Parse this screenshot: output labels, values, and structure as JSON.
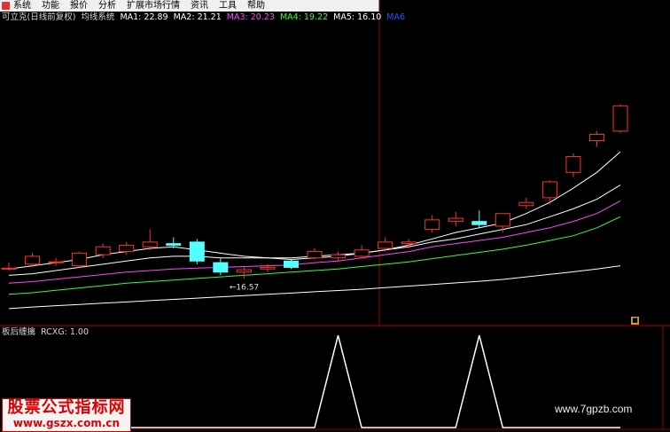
{
  "menu": {
    "items": [
      "系统",
      "功能",
      "报价",
      "分析",
      "扩展市场行情",
      "资讯",
      "工具",
      "帮助"
    ]
  },
  "header": {
    "stock_title": "可立克(日线前复权)",
    "indicator_name": "均线系统",
    "ma": [
      {
        "label": "MA1: 22.89",
        "color": "#ffffff"
      },
      {
        "label": "MA2: 21.21",
        "color": "#ffffff"
      },
      {
        "label": "MA3: 20.23",
        "color": "#ff44ff"
      },
      {
        "label": "MA4: 19.22",
        "color": "#33ff33"
      },
      {
        "label": "MA5: 16.10",
        "color": "#ffffff"
      },
      {
        "label": "MA6",
        "color": "#3050ff"
      }
    ]
  },
  "lower": {
    "title": "板后缠擒",
    "value_label": "RCXG: 1.00"
  },
  "annotation": {
    "low_price": "←16.57"
  },
  "watermarks": {
    "left_cn": "股票公式指标网",
    "left_url": "www.gszx.com.cn",
    "right_url": "www.7gpzb.com"
  },
  "colors": {
    "up": "#ff3030",
    "down": "#54ffff",
    "separator": "#b00000",
    "axis": "#9a0000"
  },
  "chart_data": [
    {
      "type": "candlestick",
      "title": "",
      "candles": [
        {
          "o": 15.9,
          "h": 16.3,
          "l": 15.8,
          "c": 15.95
        },
        {
          "o": 16.2,
          "h": 16.9,
          "l": 16.0,
          "c": 16.7
        },
        {
          "o": 16.3,
          "h": 16.6,
          "l": 16.1,
          "c": 16.35
        },
        {
          "o": 16.1,
          "h": 17.0,
          "l": 16.0,
          "c": 16.9
        },
        {
          "o": 16.8,
          "h": 17.5,
          "l": 16.6,
          "c": 17.3
        },
        {
          "o": 17.0,
          "h": 17.6,
          "l": 16.8,
          "c": 17.4
        },
        {
          "o": 17.3,
          "h": 18.4,
          "l": 17.1,
          "c": 17.6
        },
        {
          "o": 17.5,
          "h": 17.9,
          "l": 17.2,
          "c": 17.4
        },
        {
          "o": 17.6,
          "h": 17.8,
          "l": 16.2,
          "c": 16.4
        },
        {
          "o": 16.3,
          "h": 16.6,
          "l": 15.5,
          "c": 15.7
        },
        {
          "o": 15.7,
          "h": 16.0,
          "l": 15.3,
          "c": 15.85
        },
        {
          "o": 15.9,
          "h": 16.2,
          "l": 15.7,
          "c": 16.0
        },
        {
          "o": 16.4,
          "h": 16.5,
          "l": 15.9,
          "c": 16.0
        },
        {
          "o": 16.6,
          "h": 17.2,
          "l": 16.5,
          "c": 17.0
        },
        {
          "o": 16.6,
          "h": 17.0,
          "l": 16.4,
          "c": 16.8
        },
        {
          "o": 16.7,
          "h": 17.4,
          "l": 16.6,
          "c": 17.1
        },
        {
          "o": 17.2,
          "h": 17.9,
          "l": 17.0,
          "c": 17.6
        },
        {
          "o": 17.5,
          "h": 17.8,
          "l": 17.2,
          "c": 17.6
        },
        {
          "o": 18.4,
          "h": 19.3,
          "l": 18.2,
          "c": 19.0
        },
        {
          "o": 18.9,
          "h": 19.5,
          "l": 18.6,
          "c": 19.1
        },
        {
          "o": 18.9,
          "h": 19.6,
          "l": 18.5,
          "c": 18.7
        },
        {
          "o": 18.6,
          "h": 19.4,
          "l": 18.2,
          "c": 19.4
        },
        {
          "o": 19.9,
          "h": 20.4,
          "l": 19.7,
          "c": 20.1
        },
        {
          "o": 20.4,
          "h": 21.5,
          "l": 20.0,
          "c": 21.4
        },
        {
          "o": 22.0,
          "h": 23.2,
          "l": 21.7,
          "c": 23.0
        },
        {
          "o": 24.0,
          "h": 24.6,
          "l": 23.6,
          "c": 24.4
        },
        {
          "o": 24.6,
          "h": 26.3,
          "l": 24.5,
          "c": 26.2
        }
      ],
      "ma_series": [
        {
          "color": "#ffffff",
          "values": [
            15.9,
            16.1,
            16.3,
            16.5,
            16.8,
            17.0,
            17.2,
            17.3,
            17.1,
            16.9,
            16.7,
            16.6,
            16.5,
            16.6,
            16.7,
            16.9,
            17.1,
            17.4,
            17.8,
            18.2,
            18.5,
            18.8,
            19.4,
            20.1,
            21.0,
            22.0,
            23.3
          ]
        },
        {
          "color": "#ffffff",
          "values": [
            15.5,
            15.6,
            15.8,
            16.0,
            16.2,
            16.4,
            16.6,
            16.7,
            16.7,
            16.6,
            16.6,
            16.6,
            16.6,
            16.7,
            16.8,
            16.9,
            17.1,
            17.3,
            17.6,
            17.8,
            18.1,
            18.4,
            18.7,
            19.2,
            19.7,
            20.3,
            21.2
          ]
        },
        {
          "color": "#ff44ff",
          "values": [
            15.0,
            15.1,
            15.25,
            15.4,
            15.55,
            15.7,
            15.8,
            15.9,
            15.95,
            16.0,
            16.05,
            16.1,
            16.15,
            16.3,
            16.4,
            16.6,
            16.8,
            17.0,
            17.3,
            17.5,
            17.7,
            17.9,
            18.2,
            18.5,
            18.9,
            19.4,
            20.2
          ]
        },
        {
          "color": "#33ff33",
          "values": [
            14.3,
            14.4,
            14.55,
            14.7,
            14.85,
            15.0,
            15.1,
            15.2,
            15.3,
            15.4,
            15.5,
            15.6,
            15.7,
            15.8,
            15.9,
            16.05,
            16.2,
            16.35,
            16.55,
            16.75,
            16.95,
            17.15,
            17.4,
            17.7,
            18.0,
            18.5,
            19.2
          ]
        },
        {
          "color": "#ffffff",
          "values": [
            13.4,
            13.5,
            13.58,
            13.66,
            13.74,
            13.82,
            13.9,
            13.98,
            14.06,
            14.14,
            14.22,
            14.3,
            14.38,
            14.46,
            14.54,
            14.62,
            14.72,
            14.82,
            14.92,
            15.02,
            15.12,
            15.24,
            15.4,
            15.56,
            15.72,
            15.9,
            16.1
          ]
        }
      ]
    },
    {
      "type": "line",
      "title": "",
      "series": [
        {
          "values": [
            0,
            0,
            0,
            0,
            0,
            0,
            0,
            0,
            0,
            0,
            0,
            0,
            0,
            0,
            1,
            0,
            0,
            0,
            0,
            0,
            1,
            0,
            0,
            0,
            0,
            0,
            0
          ]
        }
      ]
    }
  ]
}
